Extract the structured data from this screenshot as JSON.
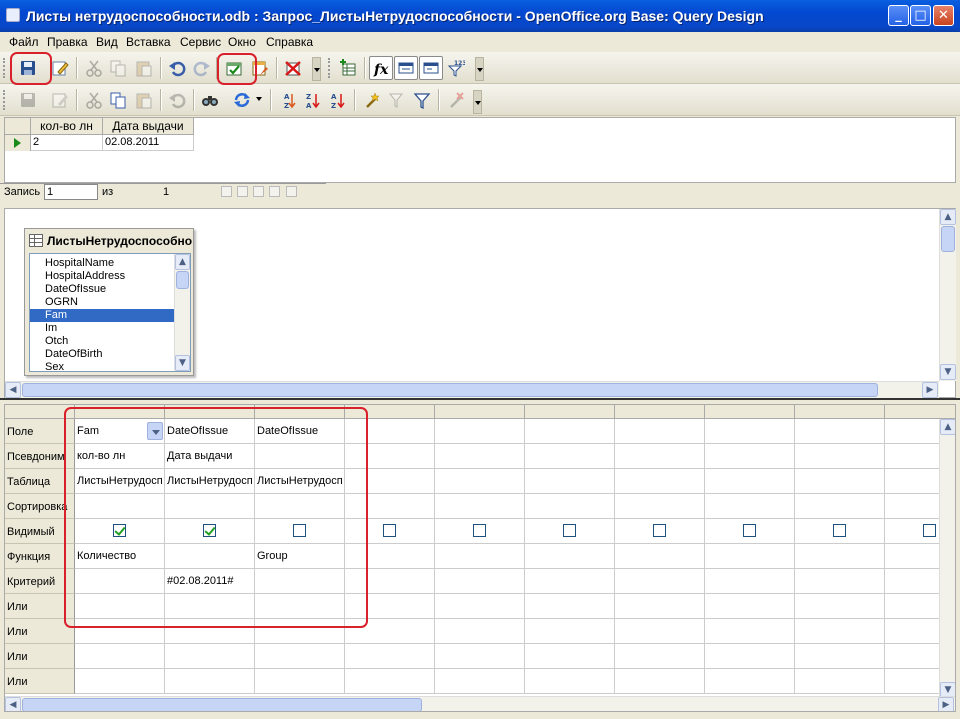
{
  "window": {
    "title": "Листы нетрудоспособности.odb : Запрос_ЛистыНетрудоспособности - OpenOffice.org Base: Query Design",
    "minimize": "_",
    "maximize": "□",
    "close": "✕"
  },
  "menu": [
    "Файл",
    "Правка",
    "Вид",
    "Вставка",
    "Сервис",
    "Окно",
    "Справка"
  ],
  "toolbar1": [
    {
      "name": "save-icon",
      "disabled": false
    },
    {
      "name": "edit-icon",
      "disabled": false
    },
    {
      "name": "cut-icon",
      "disabled": true
    },
    {
      "name": "copy-icon",
      "disabled": true
    },
    {
      "name": "paste-icon",
      "disabled": true
    },
    {
      "name": "undo-icon",
      "disabled": false
    },
    {
      "name": "redo-icon",
      "disabled": true
    },
    {
      "name": "run-query-icon",
      "disabled": false
    },
    {
      "name": "clear-query-icon",
      "disabled": false
    },
    {
      "name": "toggle-design-icon",
      "disabled": false
    },
    {
      "name": "add-table-icon",
      "disabled": false
    },
    {
      "name": "functions-icon",
      "disabled": false
    },
    {
      "name": "table-name-icon",
      "disabled": false
    },
    {
      "name": "alias-icon",
      "disabled": false
    },
    {
      "name": "distinct-values-icon",
      "disabled": false
    }
  ],
  "toolbar2": [
    {
      "name": "save-record-icon",
      "disabled": true
    },
    {
      "name": "edit-data-icon",
      "disabled": true
    },
    {
      "name": "cut-icon",
      "disabled": true
    },
    {
      "name": "copy-icon",
      "disabled": false
    },
    {
      "name": "paste-icon",
      "disabled": true
    },
    {
      "name": "undo-icon",
      "disabled": true
    },
    {
      "name": "find-record-icon",
      "disabled": false
    },
    {
      "name": "refresh-icon",
      "disabled": false
    },
    {
      "name": "sort-ascending-icon",
      "disabled": false
    },
    {
      "name": "sort-descending-icon",
      "disabled": false
    },
    {
      "name": "sort-icon",
      "disabled": false
    },
    {
      "name": "autofilter-icon",
      "disabled": false
    },
    {
      "name": "apply-filter-icon",
      "disabled": true
    },
    {
      "name": "standard-filter-icon",
      "disabled": false
    },
    {
      "name": "remove-filter-icon",
      "disabled": true
    }
  ],
  "result": {
    "headers": [
      "кол-во лн",
      "Дата выдачи"
    ],
    "rows": [
      [
        "2",
        "02.08.2011"
      ]
    ]
  },
  "navigation": {
    "record_label": "Запись",
    "record_value": "1",
    "of_label": "из",
    "total": "1"
  },
  "table_window": {
    "title": "ЛистыНетрудоспособно",
    "fields": [
      "HospitalName",
      "HospitalAddress",
      "DateOfIssue",
      "OGRN",
      "Fam",
      "Im",
      "Otch",
      "DateOfBirth",
      "Sex"
    ],
    "selected": "Fam"
  },
  "design_grid": {
    "row_labels": [
      "Поле",
      "Псевдоним",
      "Таблица",
      "Сортировка",
      "Видимый",
      "Функция",
      "Критерий",
      "Или",
      "Или",
      "Или",
      "Или"
    ],
    "columns": [
      {
        "field": "Fam",
        "alias": "кол-во лн",
        "table": "ЛистыНетрудосп",
        "sort": "",
        "visible": true,
        "function": "Количество",
        "criterion": ""
      },
      {
        "field": "DateOfIssue",
        "alias": "Дата выдачи",
        "table": "ЛистыНетрудосп",
        "sort": "",
        "visible": true,
        "function": "",
        "criterion": "#02.08.2011#"
      },
      {
        "field": "DateOfIssue",
        "alias": "",
        "table": "ЛистыНетрудосп",
        "sort": "",
        "visible": false,
        "function": "Group",
        "criterion": ""
      },
      {
        "field": "",
        "alias": "",
        "table": "",
        "sort": "",
        "visible": false,
        "function": "",
        "criterion": ""
      },
      {
        "field": "",
        "alias": "",
        "table": "",
        "sort": "",
        "visible": false,
        "function": "",
        "criterion": ""
      },
      {
        "field": "",
        "alias": "",
        "table": "",
        "sort": "",
        "visible": false,
        "function": "",
        "criterion": ""
      },
      {
        "field": "",
        "alias": "",
        "table": "",
        "sort": "",
        "visible": false,
        "function": "",
        "criterion": ""
      },
      {
        "field": "",
        "alias": "",
        "table": "",
        "sort": "",
        "visible": false,
        "function": "",
        "criterion": ""
      },
      {
        "field": "",
        "alias": "",
        "table": "",
        "sort": "",
        "visible": false,
        "function": "",
        "criterion": ""
      },
      {
        "field": "",
        "alias": "",
        "table": "",
        "sort": "",
        "visible": false,
        "function": "",
        "criterion": ""
      }
    ]
  },
  "colors": {
    "highlight": "#d8212a",
    "selection": "#316ac5",
    "titlebar": "#0348d0"
  }
}
